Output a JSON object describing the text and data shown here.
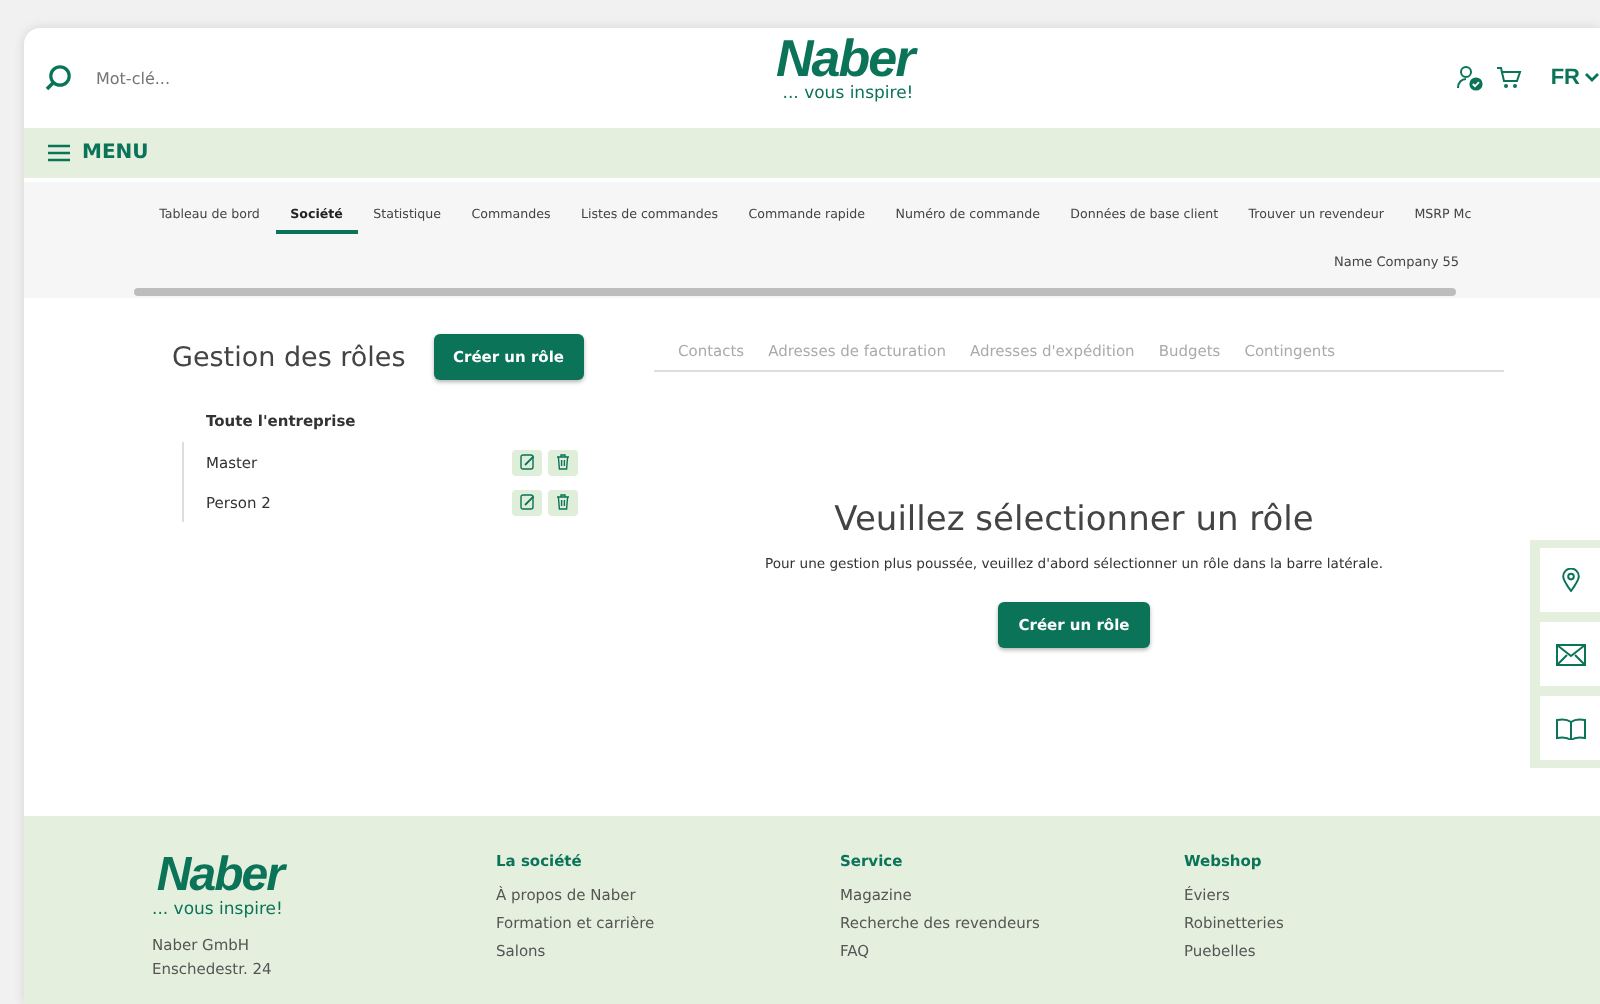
{
  "header": {
    "search": {
      "placeholder": "Mot-clé..."
    },
    "logo": {
      "name": "Naber",
      "tagline": "... vous inspire!"
    },
    "language": "FR"
  },
  "menu": {
    "label": "MENU"
  },
  "account_tabs": [
    {
      "label": "Tableau de bord",
      "selected": false
    },
    {
      "label": "Société",
      "selected": true
    },
    {
      "label": "Statistique",
      "selected": false
    },
    {
      "label": "Commandes",
      "selected": false
    },
    {
      "label": "Listes de commandes",
      "selected": false
    },
    {
      "label": "Commande rapide",
      "selected": false
    },
    {
      "label": "Numéro de commande",
      "selected": false
    },
    {
      "label": "Données de base client",
      "selected": false
    },
    {
      "label": "Trouver un revendeur",
      "selected": false
    },
    {
      "label": "MSRP Mc",
      "selected": false
    }
  ],
  "company": "Name Company 55",
  "roles": {
    "title": "Gestion des rôles",
    "create_button": "Créer un rôle",
    "root": "Toute l'entreprise",
    "items": [
      {
        "name": "Master"
      },
      {
        "name": "Person 2"
      }
    ]
  },
  "detail_tabs": [
    {
      "label": "Contacts",
      "disabled": true
    },
    {
      "label": "Adresses de facturation",
      "disabled": true
    },
    {
      "label": "Adresses d'expédition",
      "disabled": true
    },
    {
      "label": "Budgets",
      "disabled": true
    },
    {
      "label": "Contingents",
      "disabled": true
    }
  ],
  "empty_state": {
    "title": "Veuillez sélectionner un rôle",
    "text": "Pour une gestion plus poussée, veuillez d'abord sélectionner un rôle dans la barre latérale.",
    "button": "Créer un rôle"
  },
  "footer": {
    "logo": {
      "name": "Naber",
      "tagline": "... vous inspire!"
    },
    "address": [
      "Naber GmbH",
      "Enschedestr. 24"
    ],
    "columns": [
      {
        "title": "La société",
        "links": [
          "À propos de Naber",
          "Formation et carrière",
          "Salons"
        ]
      },
      {
        "title": "Service",
        "links": [
          "Magazine",
          "Recherche des revendeurs",
          "FAQ"
        ]
      },
      {
        "title": "Webshop",
        "links": [
          "Éviers",
          "Robinetteries",
          "Puebelles"
        ]
      }
    ]
  }
}
